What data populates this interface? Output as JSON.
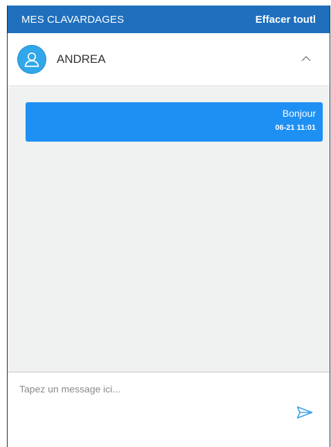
{
  "header": {
    "title": "MES CLAVARDAGES",
    "clear_label": "Effacer toutl"
  },
  "contact": {
    "name": "ANDREA",
    "avatar_icon": "user-icon",
    "collapse_icon": "chevron-up-icon"
  },
  "messages": [
    {
      "text": "Bonjour",
      "time": "06-21 11:01",
      "direction": "outgoing"
    }
  ],
  "composer": {
    "placeholder": "Tapez un message ici...",
    "value": "",
    "send_icon": "send-icon"
  },
  "colors": {
    "header_bg": "#1f6fbd",
    "bubble_bg": "#1e90f3",
    "avatar_bg": "#31a7ea",
    "chat_bg": "#f0f1f1",
    "send_icon": "#3aa0e8"
  }
}
